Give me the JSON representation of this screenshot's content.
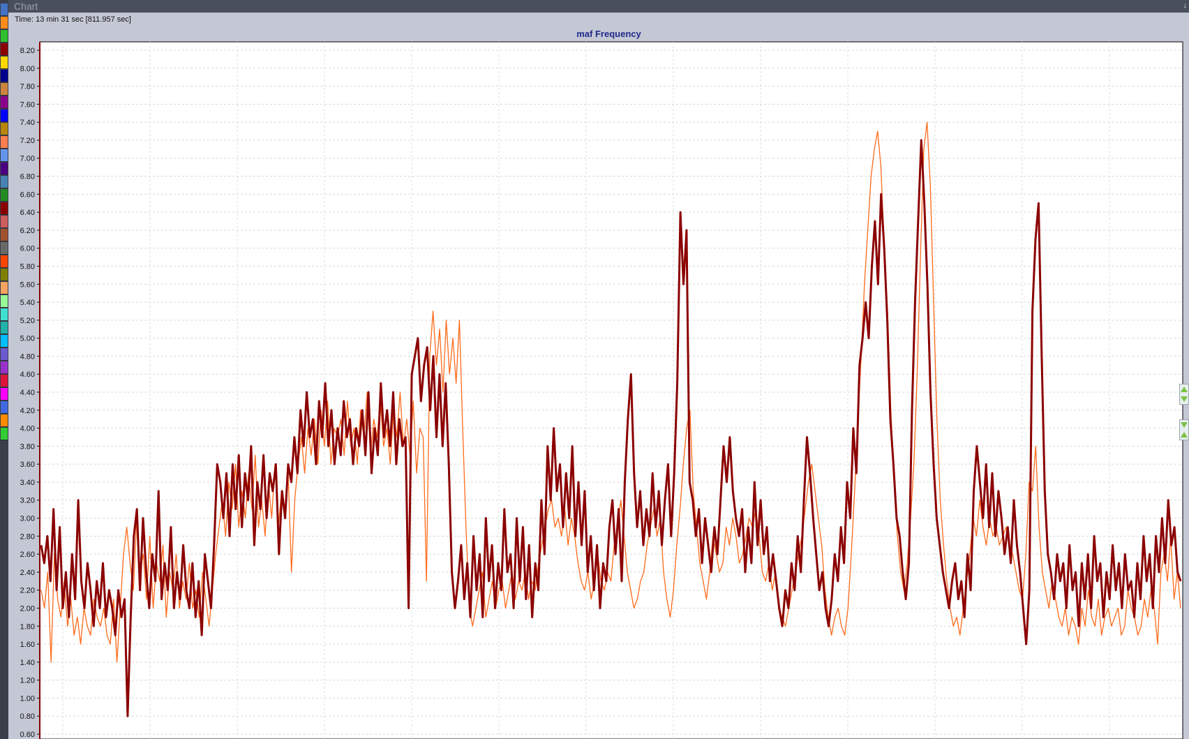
{
  "window": {
    "title": "Chart"
  },
  "time_readout": "Time: 13 min 31 sec [811.957 sec]",
  "swatch_colors": [
    "#4472c4",
    "#ff8c1a",
    "#2fbf2f",
    "#8b0000",
    "#ffd700",
    "#00008b",
    "#cd853f",
    "#8b008b",
    "#0000ff",
    "#b8860b",
    "#ff7f50",
    "#6495ed",
    "#4b0082",
    "#4682b4",
    "#228b22",
    "#8b0000",
    "#cd5c5c",
    "#a0522d",
    "#696969",
    "#ff4500",
    "#808000",
    "#f4a460",
    "#98fb98",
    "#40e0d0",
    "#20b2aa",
    "#00bfff",
    "#6a5acd",
    "#9932cc",
    "#dc143c",
    "#ff00ff",
    "#4169e1",
    "#ff8c00",
    "#32cd32"
  ],
  "side_buttons": [
    {
      "icon": "expand-arrows-icon",
      "color": "#7ac142"
    },
    {
      "icon": "collapse-arrows-icon",
      "color": "#7ac142"
    }
  ],
  "chart_data": {
    "type": "line",
    "title": "maf Frequency",
    "xlabel": "",
    "ylabel": "",
    "ylim": [
      0.6,
      8.25
    ],
    "y_ticks": [
      "8.20",
      "8.00",
      "7.80",
      "7.60",
      "7.40",
      "7.20",
      "7.00",
      "6.80",
      "6.60",
      "6.40",
      "6.20",
      "6.00",
      "5.80",
      "5.60",
      "5.40",
      "5.20",
      "5.00",
      "4.80",
      "4.60",
      "4.40",
      "4.20",
      "4.00",
      "3.80",
      "3.60",
      "3.40",
      "3.20",
      "3.00",
      "2.80",
      "2.60",
      "2.40",
      "2.20",
      "2.00",
      "1.80",
      "1.60",
      "1.40",
      "1.20",
      "1.00",
      "0.80",
      "0.60"
    ],
    "grid": true,
    "series": [
      {
        "color": "#8b0000",
        "width": 3,
        "values": [
          2.7,
          2.5,
          2.8,
          2.3,
          3.1,
          2.2,
          2.9,
          2.0,
          2.4,
          1.9,
          2.6,
          2.1,
          3.2,
          2.3,
          2.0,
          2.5,
          2.2,
          1.8,
          2.3,
          2.0,
          2.5,
          1.9,
          2.2,
          2.0,
          1.7,
          2.2,
          1.9,
          2.1,
          0.8,
          1.9,
          2.8,
          3.1,
          2.2,
          3.0,
          2.4,
          2.0,
          2.6,
          2.3,
          3.3,
          2.1,
          2.5,
          2.2,
          2.9,
          2.0,
          2.4,
          2.1,
          2.7,
          2.2,
          2.0,
          2.5,
          1.9,
          2.3,
          1.7,
          2.6,
          2.3,
          2.0,
          2.7,
          3.6,
          3.4,
          3.0,
          3.5,
          2.8,
          3.6,
          3.1,
          3.7,
          2.9,
          3.5,
          3.2,
          3.8,
          2.7,
          3.4,
          3.1,
          3.7,
          3.0,
          3.5,
          3.3,
          3.6,
          2.6,
          3.3,
          3.0,
          3.6,
          3.4,
          3.9,
          3.5,
          4.2,
          3.8,
          4.4,
          3.9,
          4.1,
          3.6,
          4.3,
          3.9,
          4.5,
          3.8,
          4.2,
          3.6,
          4.0,
          3.7,
          4.3,
          3.9,
          4.1,
          3.6,
          4.0,
          3.8,
          4.2,
          3.7,
          4.4,
          3.5,
          4.0,
          3.7,
          4.5,
          3.9,
          4.2,
          3.8,
          4.4,
          3.6,
          4.1,
          3.8,
          3.9,
          2.0,
          4.6,
          4.8,
          5.0,
          4.3,
          4.7,
          4.9,
          4.2,
          4.8,
          3.9,
          4.6,
          3.8,
          4.5,
          3.6,
          2.4,
          2.0,
          2.3,
          2.7,
          2.1,
          2.5,
          1.9,
          2.8,
          2.2,
          2.6,
          1.9,
          3.0,
          2.3,
          2.7,
          2.0,
          2.5,
          2.2,
          3.1,
          2.4,
          2.6,
          2.0,
          3.0,
          2.3,
          2.9,
          2.1,
          2.7,
          1.9,
          2.5,
          2.2,
          3.2,
          2.6,
          3.8,
          3.2,
          4.0,
          3.3,
          3.6,
          2.9,
          3.5,
          3.0,
          3.8,
          2.8,
          3.4,
          2.7,
          3.3,
          2.4,
          2.8,
          2.2,
          2.7,
          2.0,
          2.5,
          2.3,
          2.9,
          3.2,
          2.6,
          3.1,
          2.3,
          3.4,
          4.1,
          4.6,
          3.5,
          2.9,
          3.3,
          2.7,
          3.1,
          2.8,
          3.5,
          2.9,
          3.3,
          2.7,
          3.2,
          3.6,
          2.8,
          3.5,
          4.5,
          6.4,
          5.6,
          6.2,
          3.4,
          3.2,
          2.8,
          3.1,
          2.5,
          3.0,
          2.7,
          2.4,
          2.9,
          2.6,
          3.2,
          3.8,
          3.4,
          3.9,
          3.3,
          3.0,
          2.8,
          3.1,
          2.4,
          2.9,
          2.5,
          3.4,
          2.7,
          3.2,
          2.6,
          2.9,
          2.3,
          2.6,
          2.3,
          2.0,
          1.8,
          2.2,
          2.0,
          2.5,
          2.2,
          2.8,
          2.4,
          3.2,
          3.9,
          3.5,
          3.0,
          2.6,
          2.2,
          2.4,
          2.0,
          1.8,
          2.1,
          2.6,
          2.3,
          2.9,
          2.5,
          3.4,
          3.0,
          4.0,
          3.5,
          4.7,
          5.0,
          5.4,
          5.0,
          5.8,
          6.3,
          5.6,
          6.6,
          6.0,
          5.2,
          4.1,
          3.6,
          3.0,
          2.8,
          2.4,
          2.1,
          2.5,
          4.2,
          5.4,
          6.3,
          7.2,
          6.5,
          5.6,
          4.4,
          3.6,
          3.0,
          2.7,
          2.4,
          2.2,
          2.0,
          2.3,
          2.5,
          2.1,
          2.3,
          1.9,
          2.6,
          2.2,
          3.3,
          3.8,
          3.4,
          3.0,
          3.6,
          2.9,
          3.5,
          2.8,
          3.3,
          3.0,
          2.6,
          2.9,
          2.5,
          3.2,
          2.7,
          2.4,
          2.0,
          1.6,
          2.2,
          5.3,
          6.1,
          6.5,
          4.8,
          3.3,
          2.6,
          2.4,
          2.1,
          2.6,
          2.3,
          2.5,
          2.0,
          2.7,
          2.2,
          2.4,
          1.8,
          2.5,
          2.1,
          2.6,
          2.0,
          2.8,
          2.3,
          2.5,
          1.9,
          2.4,
          2.1,
          2.7,
          2.2,
          2.5,
          2.0,
          2.6,
          2.2,
          2.3,
          1.9,
          2.5,
          2.1,
          2.8,
          2.3,
          2.6,
          2.0,
          2.8,
          2.4,
          3.0,
          2.5,
          3.2,
          2.7,
          2.9,
          2.4,
          2.3
        ]
      },
      {
        "color": "#ff6a1a",
        "width": 1.3,
        "values": [
          2.2,
          2.0,
          2.4,
          1.4,
          2.6,
          2.1,
          1.9,
          2.3,
          1.8,
          2.1,
          1.7,
          1.9,
          1.6,
          2.0,
          1.8,
          1.7,
          2.1,
          1.9,
          1.8,
          2.0,
          1.7,
          1.6,
          2.1,
          1.4,
          2.0,
          2.6,
          2.9,
          2.5,
          2.2,
          3.0,
          2.4,
          2.6,
          2.1,
          2.8,
          2.0,
          2.5,
          2.3,
          2.7,
          1.9,
          2.4,
          2.2,
          2.6,
          2.0,
          2.3,
          2.1,
          2.5,
          2.0,
          2.2,
          1.9,
          2.4,
          2.1,
          1.8,
          2.2,
          2.6,
          2.9,
          3.2,
          2.8,
          3.4,
          3.1,
          3.6,
          2.9,
          3.3,
          3.0,
          3.5,
          3.1,
          3.7,
          2.9,
          3.2,
          2.8,
          3.4,
          3.0,
          3.6,
          2.9,
          3.3,
          3.1,
          3.5,
          2.4,
          3.2,
          3.6,
          3.9,
          3.5,
          4.0,
          3.7,
          4.1,
          3.6,
          4.2,
          3.8,
          4.3,
          3.6,
          4.0,
          3.9,
          4.1,
          3.7,
          4.3,
          3.8,
          4.0,
          3.6,
          4.2,
          3.9,
          4.4,
          3.7,
          4.1,
          3.9,
          4.3,
          3.8,
          4.0,
          3.6,
          4.2,
          3.9,
          4.4,
          3.8,
          4.1,
          3.7,
          4.3,
          3.5,
          4.0,
          3.9,
          2.3,
          4.8,
          5.3,
          4.7,
          5.1,
          4.4,
          5.2,
          4.6,
          5.0,
          4.5,
          5.2,
          4.0,
          2.9,
          2.0,
          1.8,
          2.0,
          2.2,
          2.4,
          1.9,
          2.1,
          2.3,
          2.0,
          2.2,
          2.3,
          2.0,
          2.2,
          2.4,
          2.1,
          2.3,
          2.2,
          2.4,
          2.1,
          2.3,
          2.2,
          2.5,
          2.7,
          2.9,
          3.1,
          3.2,
          2.9,
          3.0,
          2.8,
          3.1,
          2.7,
          3.0,
          2.8,
          2.5,
          2.3,
          2.2,
          2.4,
          2.1,
          2.3,
          2.6,
          2.3,
          2.2,
          2.4,
          2.3,
          2.7,
          2.9,
          3.2,
          2.8,
          2.4,
          2.2,
          2.0,
          2.1,
          2.3,
          2.4,
          2.7,
          2.9,
          3.1,
          2.8,
          3.0,
          2.4,
          2.1,
          1.9,
          2.2,
          2.7,
          3.1,
          3.6,
          4.0,
          4.2,
          3.3,
          2.9,
          2.5,
          2.3,
          2.1,
          2.4,
          2.8,
          2.6,
          2.4,
          2.5,
          2.9,
          2.7,
          3.0,
          2.8,
          2.5,
          2.6,
          2.8,
          3.0,
          2.9,
          3.1,
          2.8,
          2.4,
          2.3,
          2.5,
          2.2,
          2.4,
          2.0,
          1.9,
          1.8,
          2.0,
          2.2,
          2.4,
          2.6,
          2.8,
          3.1,
          3.4,
          3.6,
          3.3,
          3.0,
          2.7,
          2.2,
          1.9,
          1.7,
          1.9,
          2.0,
          1.8,
          1.7,
          2.0,
          2.6,
          3.3,
          4.1,
          4.8,
          5.6,
          6.2,
          6.8,
          7.1,
          7.3,
          6.9,
          6.0,
          5.3,
          4.2,
          3.4,
          2.8,
          2.4,
          2.2,
          2.5,
          3.0,
          3.6,
          4.6,
          5.9,
          7.1,
          7.4,
          6.7,
          5.4,
          4.1,
          3.2,
          2.7,
          2.3,
          2.0,
          1.8,
          1.9,
          1.7,
          2.0,
          2.3,
          2.6,
          3.0,
          2.8,
          3.2,
          2.9,
          2.7,
          3.0,
          2.8,
          2.9,
          2.7,
          2.8,
          2.9,
          2.7,
          2.6,
          2.4,
          2.2,
          2.1,
          2.6,
          3.4,
          3.3,
          3.8,
          2.9,
          2.4,
          2.2,
          2.0,
          2.3,
          2.1,
          1.9,
          1.8,
          2.0,
          1.7,
          1.9,
          1.8,
          1.6,
          2.0,
          1.8,
          2.2,
          1.9,
          1.8,
          2.1,
          1.7,
          1.9,
          2.0,
          1.8,
          1.9,
          2.0,
          1.7,
          1.8,
          2.2,
          2.0,
          1.9,
          1.7,
          1.8,
          2.1,
          1.9,
          2.2,
          2.0,
          1.6,
          2.4,
          2.6,
          2.3,
          2.8,
          2.1,
          2.4,
          2.0
        ]
      }
    ]
  }
}
